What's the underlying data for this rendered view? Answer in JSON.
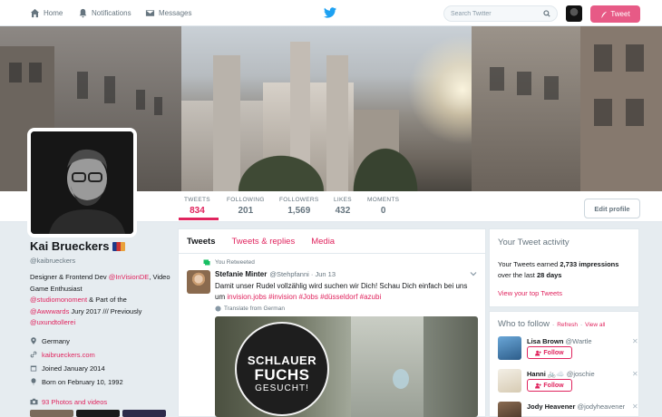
{
  "nav": {
    "home": "Home",
    "notifications": "Notifications",
    "messages": "Messages",
    "search_placeholder": "Search Twitter",
    "tweet_button": "Tweet"
  },
  "stats": [
    {
      "label": "TWEETS",
      "value": "834"
    },
    {
      "label": "FOLLOWING",
      "value": "201"
    },
    {
      "label": "FOLLOWERS",
      "value": "1,569"
    },
    {
      "label": "LIKES",
      "value": "432"
    },
    {
      "label": "MOMENTS",
      "value": "0"
    }
  ],
  "edit_profile": "Edit profile",
  "profile": {
    "name": "Kai Brueckers",
    "handle": "@kaibrueckers",
    "bio_1": "Designer & Frontend Dev ",
    "bio_link_1": "@InVisionDE",
    "bio_2": ", Video Game Enthusiast",
    "bio_link_2": "@studiomonoment",
    "bio_3": " & Part of the",
    "bio_link_3": "@Awwwards",
    "bio_4": " Jury 2017 /// Previously",
    "bio_link_4": "@uxundtollerei",
    "location": "Germany",
    "website": "kaibrueckers.com",
    "joined": "Joined January 2014",
    "born": "Born on February 10, 1992",
    "photos": "93 Photos and videos"
  },
  "tabs": [
    "Tweets",
    "Tweets & replies",
    "Media"
  ],
  "tweet": {
    "retweeted_label": "You Retweeted",
    "author_name": "Stefanie Minter",
    "author_handle": "@Stehpfanni · Jun 13",
    "text_1": "Damit unser Rudel vollzählig wird suchen wir Dich! Schau Dich einfach bei uns um ",
    "tags": "invision.jobs #invision #Jobs #düsseldorf #azubi",
    "translate": "Translate from German",
    "media_line1": "SCHLAUER",
    "media_line2": "FUCHS",
    "media_line3": "GESUCHT!"
  },
  "activity": {
    "title": "Your Tweet activity",
    "text_1": "Your Tweets earned ",
    "impressions": "2,733 impressions",
    "text_2": "over the last ",
    "period": "28 days",
    "link": "View your top Tweets"
  },
  "who_to_follow": {
    "title": "Who to follow",
    "refresh": "Refresh",
    "view_all": "View all",
    "follow_label": "Follow",
    "people": [
      {
        "name": "Lisa Brown",
        "handle": "@Wartle"
      },
      {
        "name": "Hanni 🚲☁️",
        "handle": "@joschie"
      },
      {
        "name": "Jody Heavener",
        "handle": "@jodyheavener"
      }
    ]
  }
}
